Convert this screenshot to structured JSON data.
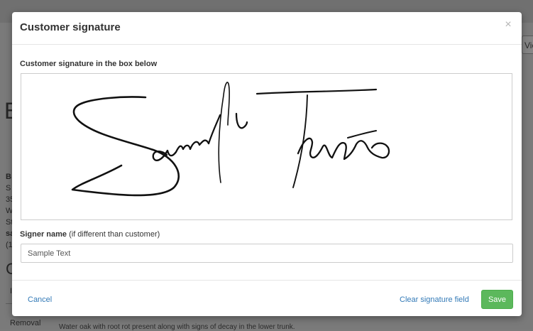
{
  "background": {
    "view_button_label": "Vie",
    "big_letter": "B",
    "lines": [
      "B",
      "S",
      "35",
      "W",
      "St",
      "sa",
      "(1"
    ],
    "section_letter": "C",
    "small_label": "I",
    "removal_label": "Removal",
    "note_text": "Water oak with root rot present along with signs of decay in the lower trunk."
  },
  "modal": {
    "title": "Customer signature",
    "close_glyph": "×",
    "signature_label": "Customer signature in the box below",
    "signature_text": "Sample Text",
    "signer_label_bold": "Signer name",
    "signer_label_note": " (if different than customer)",
    "signer_value": "Sample Text",
    "cancel_label": "Cancel",
    "clear_label": "Clear signature field",
    "save_label": "Save"
  },
  "colors": {
    "save_green": "#5cb85c",
    "link_blue": "#337ab7",
    "overlay_gray": "#7a7a7a"
  }
}
